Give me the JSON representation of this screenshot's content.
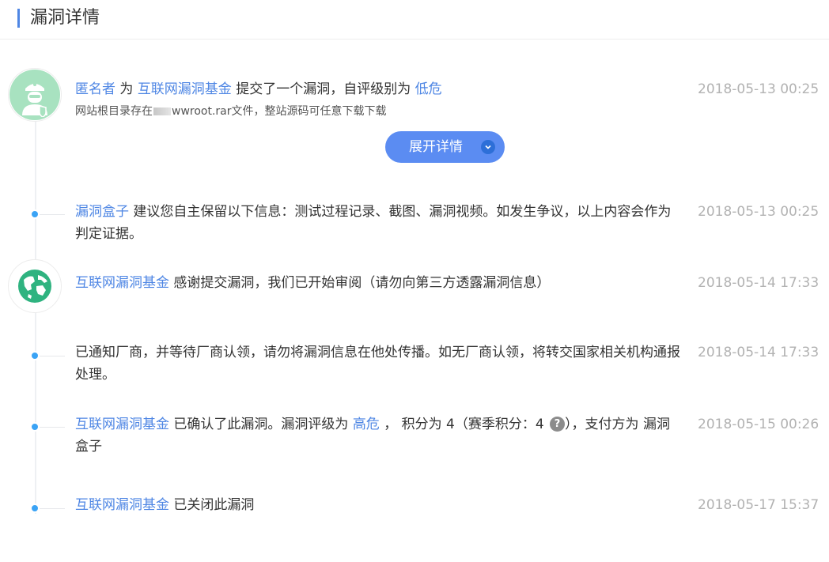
{
  "header": {
    "title": "漏洞详情"
  },
  "events": [
    {
      "actor": "匿名者",
      "text_1": " 为 ",
      "target": "互联网漏洞基金",
      "text_2": " 提交了一个漏洞，自评级别为 ",
      "level": "低危",
      "subline_pre": "网站根目录存在",
      "subline_post": "wwroot.rar文件，整站源码可任意下载下载",
      "time": "2018-05-13 00:25",
      "avatar_icon": "anonymous-user-icon"
    },
    {
      "actor": "漏洞盒子",
      "text": " 建议您自主保留以下信息：测试过程记录、截图、漏洞视频。如发生争议，以上内容会作为判定证据。",
      "time": "2018-05-13 00:25"
    },
    {
      "actor": "互联网漏洞基金",
      "text": " 感谢提交漏洞，我们已开始审阅（请勿向第三方透露漏洞信息）",
      "time": "2018-05-14 17:33",
      "avatar_icon": "globe-icon"
    },
    {
      "text": "已通知厂商，并等待厂商认领，请勿将漏洞信息在他处传播。如无厂商认领，将转交国家相关机构通报处理。",
      "time": "2018-05-14 17:33"
    },
    {
      "actor": "互联网漏洞基金",
      "text_1": " 已确认了此漏洞。漏洞评级为 ",
      "level": "高危",
      "text_2": " ， 积分为 4（赛季积分：4 ",
      "help": "?",
      "text_3": "），支付方为 漏洞盒子",
      "time": "2018-05-15 00:26"
    },
    {
      "actor": "互联网漏洞基金",
      "text": " 已关闭此漏洞",
      "time": "2018-05-17 15:37"
    }
  ],
  "expand_button": {
    "label": "展开详情"
  },
  "colors": {
    "accent": "#4e86e4",
    "button": "#5b8cf2",
    "dot": "#3aa3f5",
    "time": "#b2b2b2"
  }
}
